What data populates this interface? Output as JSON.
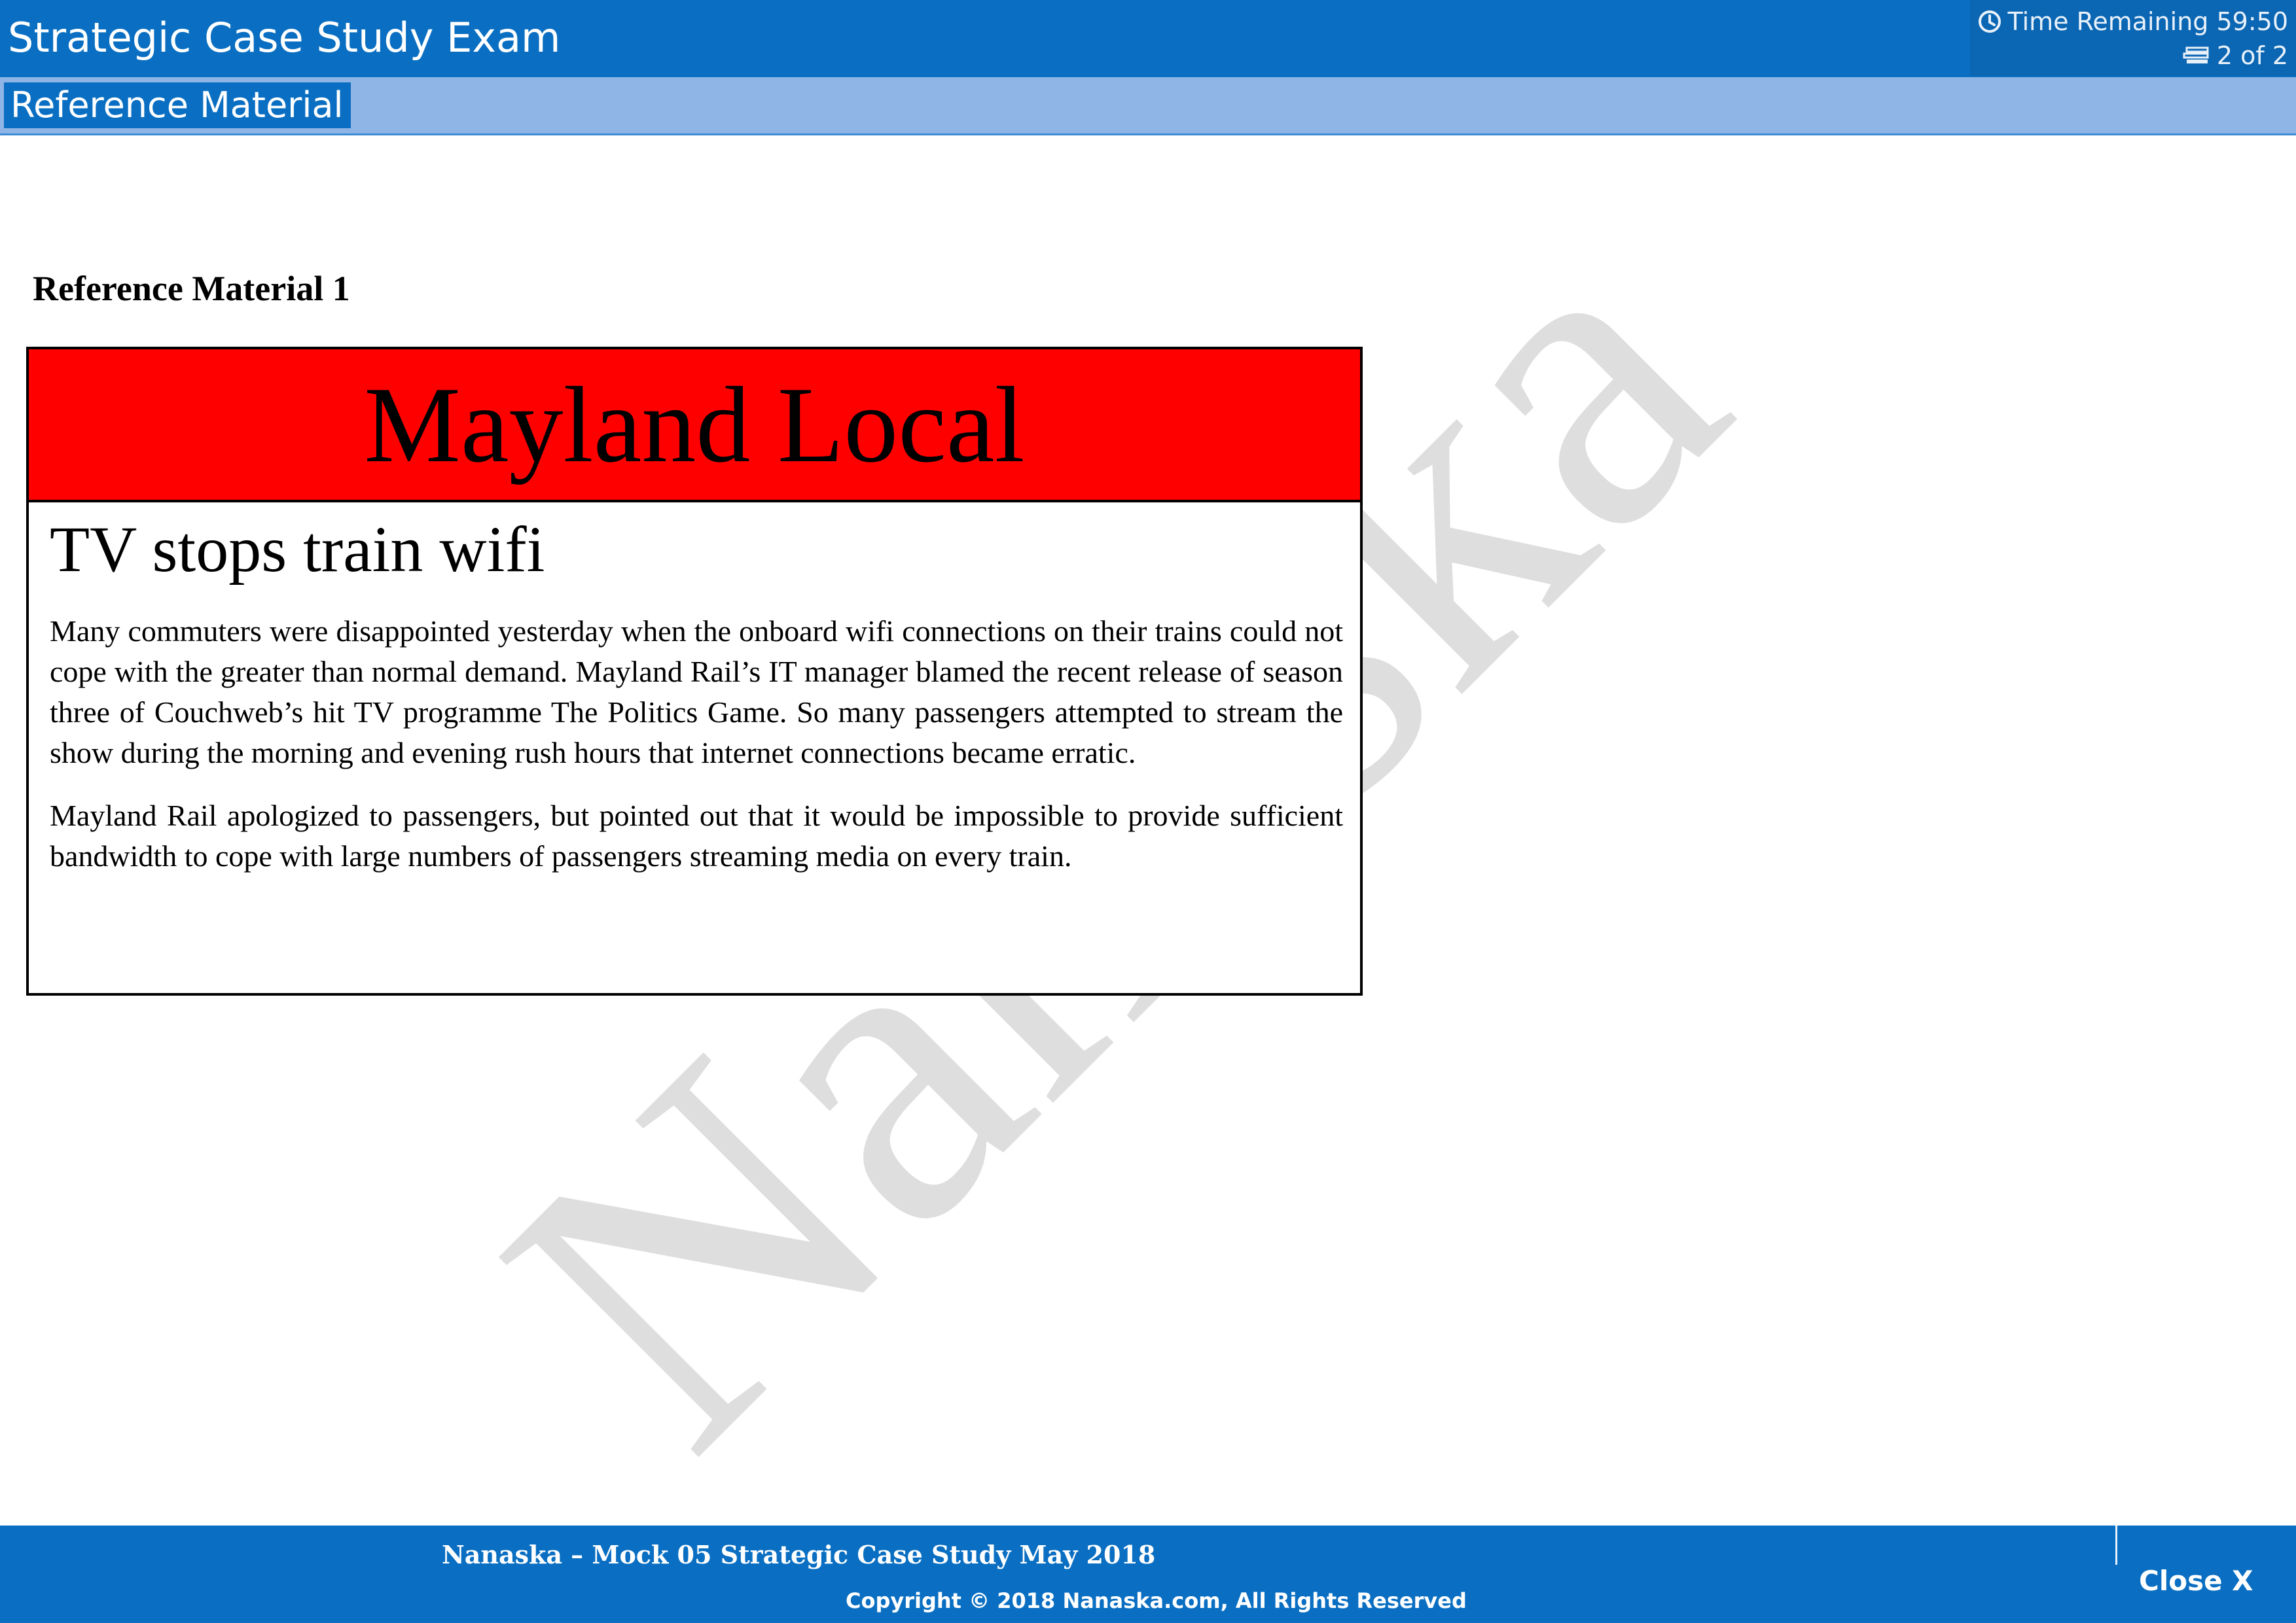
{
  "header": {
    "title": "Strategic Case Study Exam",
    "timer_label": "Time Remaining 59:50",
    "page_indicator": "2 of 2"
  },
  "tabs": [
    {
      "label": "Reference Material"
    }
  ],
  "main": {
    "reference_heading": "Reference Material 1",
    "article": {
      "masthead": "Mayland Local",
      "headline": "TV stops train wifi",
      "paragraphs": [
        "Many commuters were disappointed yesterday when the onboard wifi connections on their trains could not cope with the greater than normal demand. Mayland Rail’s IT manager blamed the recent release of season three of Couchweb’s hit TV programme The Politics Game. So many passengers attempted to stream the show during the morning and evening rush hours that internet connections became erratic.",
        "Mayland Rail apologized to passengers, but pointed out that it would be impossible to provide sufficient bandwidth to cope with large numbers of passengers streaming media on every train."
      ]
    },
    "watermark": "Nanaska"
  },
  "footer": {
    "title": "Nanaska – Mock 05 Strategic Case Study May 2018",
    "copyright": "Copyright © 2018 Nanaska.com, All Rights Reserved",
    "close_label": "Close X"
  },
  "icons": {
    "timer": "clock-icon",
    "pager": "navigator-icon"
  },
  "colors": {
    "header_blue": "#0a6fc2",
    "tabbar_light_blue": "#8eb5e6",
    "masthead_red": "#ff0000"
  }
}
